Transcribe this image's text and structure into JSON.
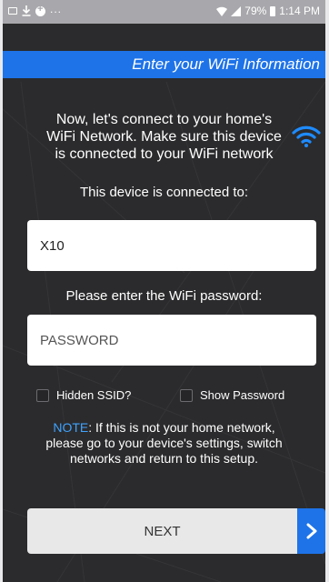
{
  "status_bar": {
    "battery": "79%",
    "time": "1:14 PM",
    "overflow": "..."
  },
  "header": {
    "title": "Enter your WiFi Information"
  },
  "intro": {
    "lines": [
      "Now, let's connect to your home's",
      "WiFi Network. Make sure this device",
      "is connected to your WiFi network"
    ]
  },
  "connection": {
    "label": "This device is connected to:",
    "ssid_value": "X10"
  },
  "password": {
    "label": "Please enter the WiFi password:",
    "placeholder": "PASSWORD"
  },
  "options": {
    "hidden_ssid": "Hidden SSID?",
    "show_password": "Show Password"
  },
  "note": {
    "key": "NOTE",
    "line1": ": If this is not your home network,",
    "line2": "please go to your device's settings, switch",
    "line3": "networks and return to this setup."
  },
  "actions": {
    "next_label": "NEXT",
    "next_arrow": ">"
  },
  "colors": {
    "accent": "#1e73e8",
    "note_key": "#3fa3ff",
    "background": "#2b2b2d"
  }
}
